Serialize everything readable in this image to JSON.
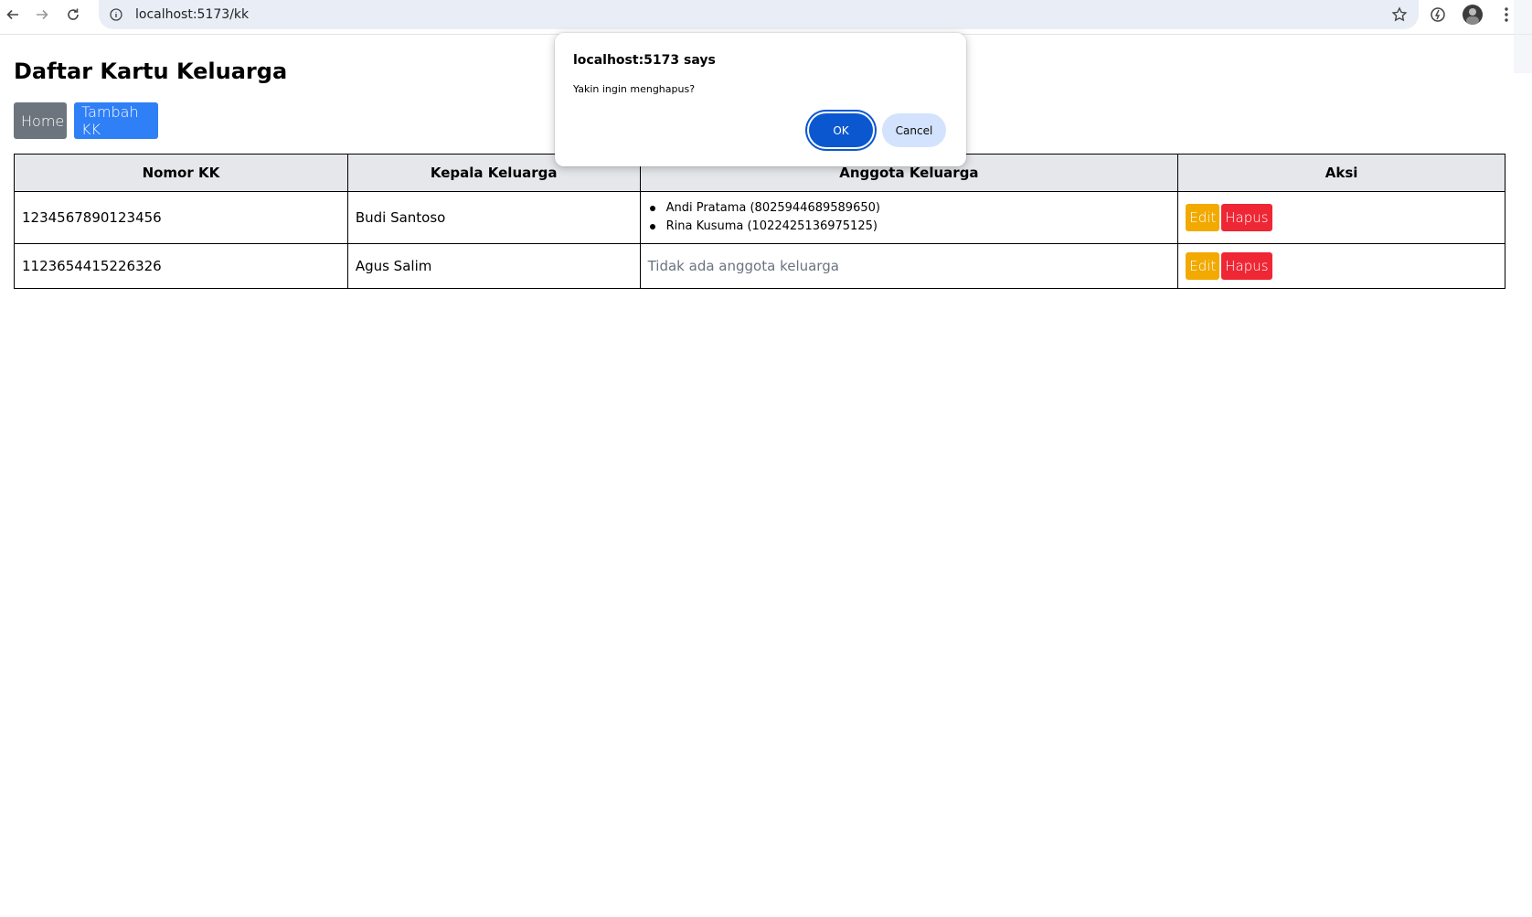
{
  "browser": {
    "url": "localhost:5173/kk"
  },
  "page": {
    "title": "Daftar Kartu Keluarga",
    "home_label": "Home",
    "add_label": "Tambah KK"
  },
  "table": {
    "headers": [
      "Nomor KK",
      "Kepala Keluarga",
      "Anggota Keluarga",
      "Aksi"
    ],
    "rows": [
      {
        "nomor_kk": "1234567890123456",
        "kepala": "Budi Santoso",
        "anggota": [
          "Andi Pratama (8025944689589650)",
          "Rina Kusuma (1022425136975125)"
        ],
        "edit_label": "Edit",
        "delete_label": "Hapus"
      },
      {
        "nomor_kk": "1123654415226326",
        "kepala": "Agus Salim",
        "empty_text": "Tidak ada anggota keluarga",
        "edit_label": "Edit",
        "delete_label": "Hapus"
      }
    ]
  },
  "dialog": {
    "title": "localhost:5173 says",
    "message": "Yakin ingin menghapus?",
    "ok_label": "OK",
    "cancel_label": "Cancel"
  },
  "colors": {
    "home_button": "#6c757d",
    "add_button": "#2f7ff6",
    "edit_button": "#f2a900",
    "delete_button": "#ef2634",
    "dialog_ok": "#0b57d0"
  }
}
